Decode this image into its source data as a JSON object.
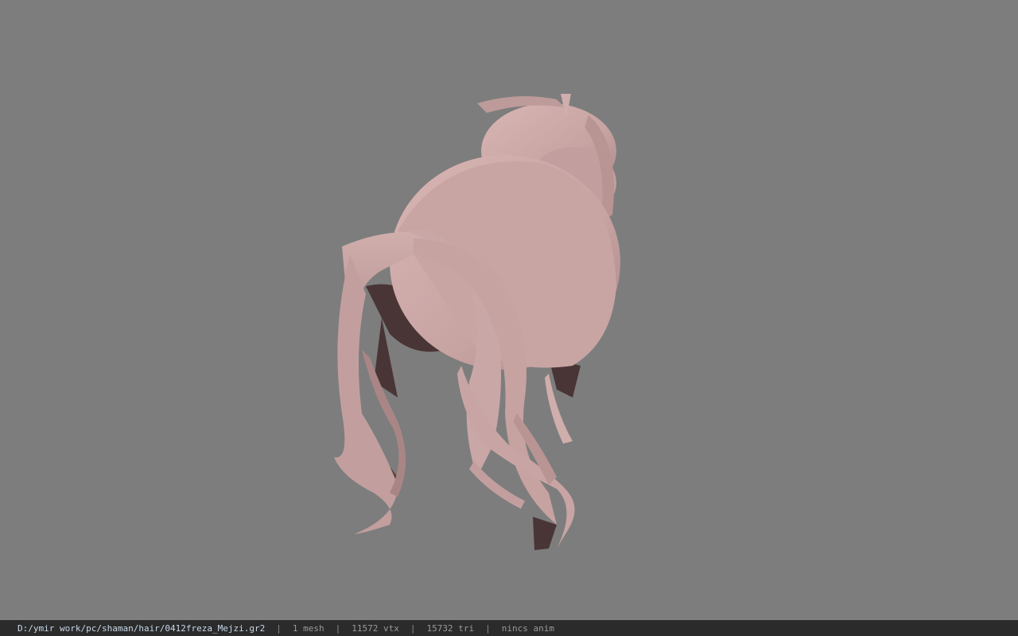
{
  "viewer": {
    "background_color": "#7d7d7d",
    "model_color": "#c9a5a4",
    "model_shadow_color": "#4a3536",
    "model_icon": "hair-mesh"
  },
  "status": {
    "file_path": "D:/ymir work/pc/shaman/hair/0412freza_Mejzi.gr2",
    "mesh_count": "1 mesh",
    "vertex_count": "11572 vtx",
    "triangle_count": "15732 tri",
    "animation": "nincs anim",
    "separator": "|"
  }
}
